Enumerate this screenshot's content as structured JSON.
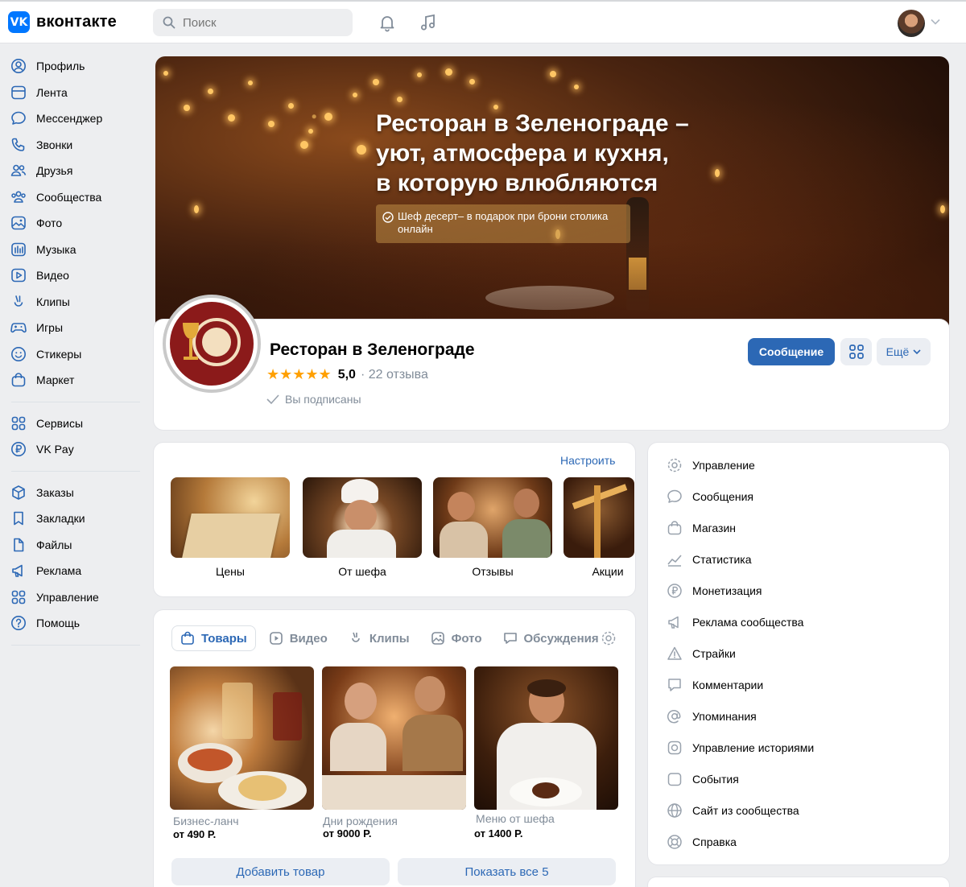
{
  "header": {
    "logo_text": "вконтакте",
    "logo_mark": "VK",
    "search_placeholder": "Поиск"
  },
  "sidebar": {
    "items": [
      {
        "label": "Профиль",
        "icon": "profile-icon"
      },
      {
        "label": "Лента",
        "icon": "feed-icon"
      },
      {
        "label": "Мессенджер",
        "icon": "messenger-icon"
      },
      {
        "label": "Звонки",
        "icon": "phone-icon"
      },
      {
        "label": "Друзья",
        "icon": "friends-icon"
      },
      {
        "label": "Сообщества",
        "icon": "communities-icon"
      },
      {
        "label": "Фото",
        "icon": "photo-icon"
      },
      {
        "label": "Музыка",
        "icon": "music-icon"
      },
      {
        "label": "Видео",
        "icon": "video-icon"
      },
      {
        "label": "Клипы",
        "icon": "clips-icon"
      },
      {
        "label": "Игры",
        "icon": "games-icon"
      },
      {
        "label": "Стикеры",
        "icon": "stickers-icon"
      },
      {
        "label": "Маркет",
        "icon": "market-icon"
      }
    ],
    "items2": [
      {
        "label": "Сервисы",
        "icon": "services-icon"
      },
      {
        "label": "VK Pay",
        "icon": "vkpay-icon"
      }
    ],
    "items3": [
      {
        "label": "Заказы",
        "icon": "orders-icon"
      },
      {
        "label": "Закладки",
        "icon": "bookmarks-icon"
      },
      {
        "label": "Файлы",
        "icon": "files-icon"
      },
      {
        "label": "Реклама",
        "icon": "ads-icon"
      },
      {
        "label": "Управление",
        "icon": "manage-icon"
      },
      {
        "label": "Помощь",
        "icon": "help-icon"
      }
    ]
  },
  "cover": {
    "title_line1": "Ресторан в Зеленограде –",
    "title_line2": "уют, атмосфера и кухня,",
    "title_line3": "в которую влюбляются",
    "badge_line1": "Шеф десерт– в подарок при брони столика",
    "badge_line2": "онлайн"
  },
  "group": {
    "name": "Ресторан в Зеленограде",
    "stars": "★★★★★",
    "rating": "5,0",
    "reviews": "· 22 отзыва",
    "subscribed": "Вы подписаны",
    "message_button": "Сообщение",
    "more_button": "Ещё"
  },
  "highlights": {
    "configure": "Настроить",
    "items": [
      "Цены",
      "От шефа",
      "Отзывы",
      "Акции"
    ]
  },
  "products": {
    "tabs": [
      "Товары",
      "Видео",
      "Клипы",
      "Фото",
      "Обсуждения"
    ],
    "items": [
      {
        "name": "Бизнес-ланч",
        "price": "от 490 Р."
      },
      {
        "name": "Дни рождения",
        "price": "от 9000 Р."
      },
      {
        "name": "Меню от шефа",
        "price": "от 1400 Р."
      }
    ],
    "add_button": "Добавить товар",
    "show_all_button": "Показать все 5"
  },
  "management": {
    "items": [
      {
        "label": "Управление",
        "icon": "gear-icon"
      },
      {
        "label": "Сообщения",
        "icon": "message-bubble-icon"
      },
      {
        "label": "Магазин",
        "icon": "shop-bag-icon"
      },
      {
        "label": "Статистика",
        "icon": "stats-icon"
      },
      {
        "label": "Монетизация",
        "icon": "ruble-icon"
      },
      {
        "label": "Реклама сообщества",
        "icon": "megaphone-icon"
      },
      {
        "label": "Страйки",
        "icon": "warning-icon"
      },
      {
        "label": "Комментарии",
        "icon": "comment-icon"
      },
      {
        "label": "Упоминания",
        "icon": "at-icon"
      },
      {
        "label": "Управление историями",
        "icon": "stories-icon"
      },
      {
        "label": "События",
        "icon": "events-icon"
      },
      {
        "label": "Сайт из сообщества",
        "icon": "globe-icon"
      },
      {
        "label": "Справка",
        "icon": "lifebuoy-icon"
      }
    ]
  },
  "colors": {
    "accent": "#2c68b5",
    "vk_blue": "#0077ff",
    "muted": "#818c99",
    "background": "#edeef0",
    "star": "#ffa000"
  }
}
